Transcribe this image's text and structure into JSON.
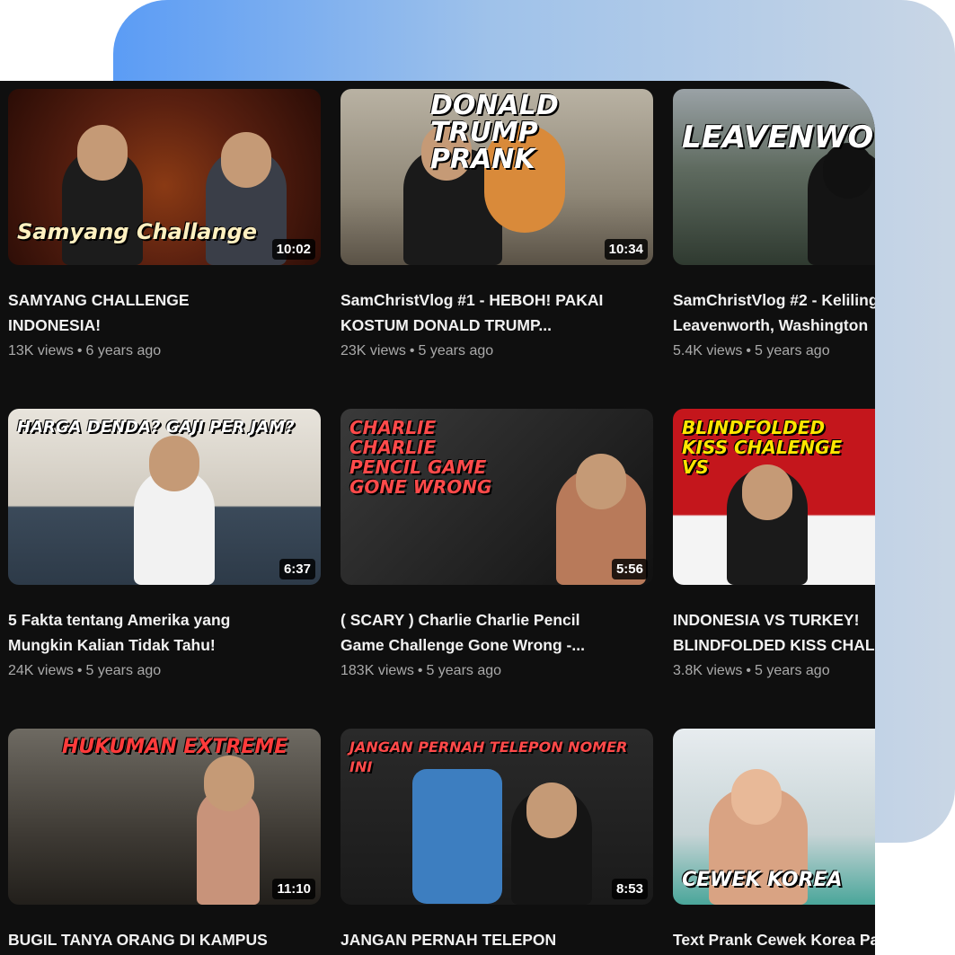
{
  "videos": [
    {
      "title": "SAMYANG CHALLENGE\nINDONESIA!",
      "views": "13K views",
      "age": "6 years ago",
      "duration": "10:02",
      "thumb_text": "Samyang Challange"
    },
    {
      "title": "SamChristVlog #1 - HEBOH! PAKAI\nKOSTUM DONALD TRUMP...",
      "views": "23K views",
      "age": "5 years ago",
      "duration": "10:34",
      "thumb_text": "DONALD TRUMP PRANK"
    },
    {
      "title": "SamChristVlog #2 - Keliling\nLeavenworth, Washington",
      "views": "5.4K views",
      "age": "5 years ago",
      "duration": "",
      "thumb_text": "LEAVENWO"
    },
    {
      "title": "5 Fakta tentang Amerika yang\nMungkin Kalian Tidak Tahu!",
      "views": "24K views",
      "age": "5 years ago",
      "duration": "6:37",
      "thumb_text": "HARGA DENDA? GAJI PER JAM?"
    },
    {
      "title": "( SCARY ) Charlie Charlie Pencil\nGame Challenge Gone Wrong -...",
      "views": "183K views",
      "age": "5 years ago",
      "duration": "5:56",
      "thumb_text": "CHARLIE CHARLIE PENCIL GAME GONE WRONG"
    },
    {
      "title": "INDONESIA VS TURKEY!\nBLINDFOLDED KISS CHALLENGE",
      "views": "3.8K views",
      "age": "5 years ago",
      "duration": "",
      "thumb_text": "BLINDFOLDED KISS CHALENGE VS"
    },
    {
      "title": "BUGIL TANYA ORANG DI KAMPUS\nAMERIKA! ( Prank Bugil )",
      "views": "",
      "age": "",
      "duration": "11:10",
      "thumb_text": "HUKUMAN EXTREME"
    },
    {
      "title": "JANGAN PERNAH TELEPON\nNOMER INI! - GONE WRONG!",
      "views": "",
      "age": "",
      "duration": "8:53",
      "thumb_text": "JANGAN PERNAH TELEPON NOMER INI"
    },
    {
      "title": "Text Prank Cewek Korea Pakai\nLagu ( EdSheeran - Happier )",
      "views": "",
      "age": "",
      "duration": "",
      "thumb_text": "CEWEK KOREA"
    }
  ],
  "separator": "•",
  "colors": {
    "background": "#0f0f0f",
    "title": "#f1f1f1",
    "meta": "#aaaaaa",
    "accent_blue": "#5b9cf5"
  }
}
